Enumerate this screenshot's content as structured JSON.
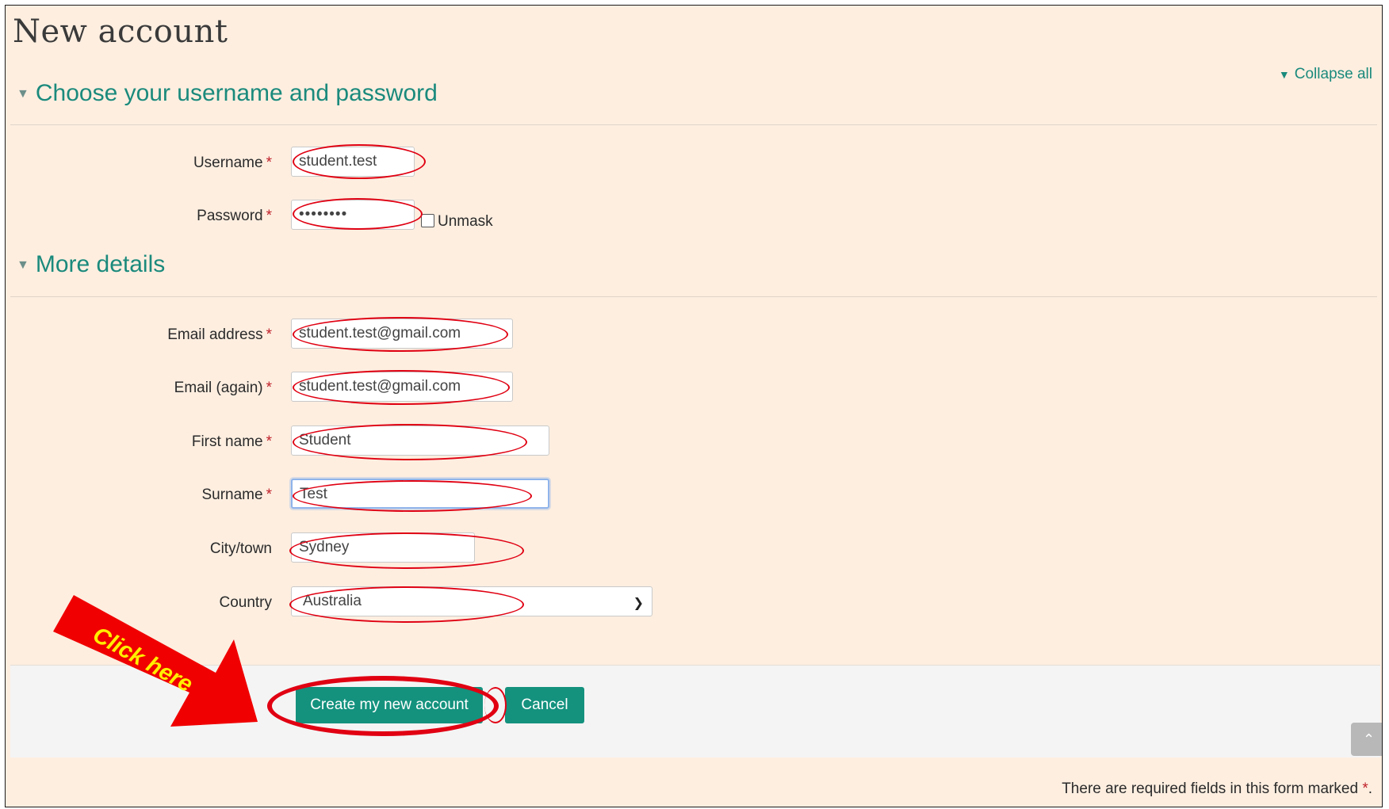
{
  "page": {
    "title": "New account",
    "collapse_all": "Collapse all"
  },
  "sections": {
    "credentials": {
      "title": "Choose your username and password"
    },
    "details": {
      "title": "More details"
    }
  },
  "fields": {
    "username": {
      "label": "Username",
      "value": "student.test"
    },
    "password": {
      "label": "Password",
      "value": "••••••••",
      "unmask_label": "Unmask"
    },
    "email": {
      "label": "Email address",
      "value": "student.test@gmail.com"
    },
    "email_again": {
      "label": "Email (again)",
      "value": "student.test@gmail.com"
    },
    "first_name": {
      "label": "First name",
      "value": "Student"
    },
    "surname": {
      "label": "Surname",
      "value": "Test"
    },
    "city": {
      "label": "City/town",
      "value": "Sydney"
    },
    "country": {
      "label": "Country",
      "value": "Australia"
    }
  },
  "required_marker": "*",
  "buttons": {
    "create": "Create my new account",
    "cancel": "Cancel"
  },
  "footer": {
    "required_note": "There are required fields in this form marked",
    "required_note_end": "."
  },
  "annotation": {
    "callout": "Click here",
    "highlight_color": "#e00012",
    "callout_text_color": "#ffee00"
  },
  "colors": {
    "accent": "#14927e",
    "link": "#1a8a7c",
    "background": "#fdeee0",
    "required": "#c0202a"
  },
  "icons": {
    "collapse": "caret-down-icon",
    "select": "chevron-down-icon",
    "scroll_top": "chevron-up-icon"
  }
}
